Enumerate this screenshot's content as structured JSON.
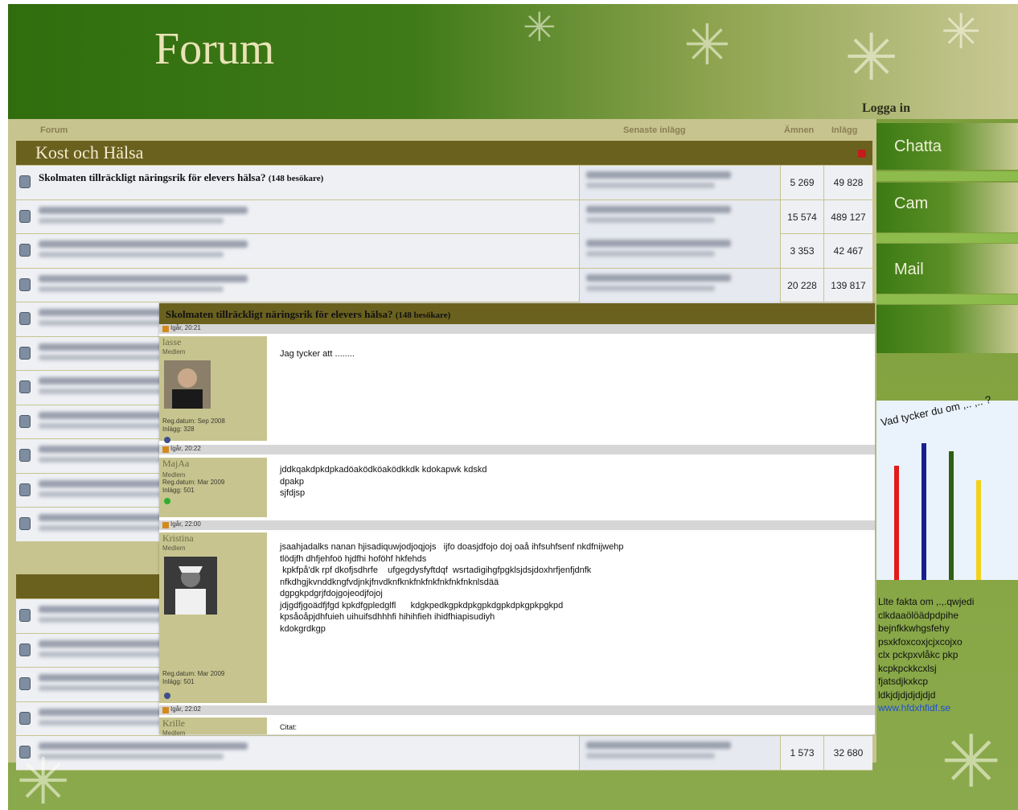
{
  "header": {
    "title": "Forum",
    "login": "Logga in"
  },
  "columns": {
    "forum": "Forum",
    "last_post": "Senaste inlägg",
    "topics": "Ämnen",
    "posts": "Inlägg"
  },
  "category": {
    "title": "Kost och Hälsa"
  },
  "rows": [
    {
      "title": "Skolmaten tillräckligt näringsrik för elevers hälsa?",
      "visitors": "(148 besökare)",
      "topics": "5 269",
      "posts": "49 828"
    },
    {
      "title": "",
      "visitors": "",
      "topics": "15 574",
      "posts": "489 127"
    },
    {
      "title": "",
      "visitors": "",
      "topics": "3 353",
      "posts": "42 467"
    },
    {
      "title": "",
      "visitors": "",
      "topics": "20 228",
      "posts": "139 817"
    }
  ],
  "last_row": {
    "topics": "1 573",
    "posts": "32 680"
  },
  "sidebar": {
    "chat": "Chatta",
    "cam": "Cam",
    "mail": "Mail"
  },
  "poll": {
    "question": "Vad tycker du om ,.. ,.. ?",
    "values": [
      0.71,
      0.85,
      0.8,
      0.62
    ],
    "colors": [
      "#e11b1b",
      "#1a1f8f",
      "#2e5f12",
      "#f2d21a"
    ]
  },
  "facts": {
    "lines": [
      "Llte fakta om ,.,.qwjedi",
      "clkdaaölöädpdpihe",
      "bejnfkkwhgsfehy",
      "psxkfoxcoxjcjxcojxo",
      "clx pckpxvlåkc pkp",
      "kcpkpckkcxlsj",
      "fjatsdjkxkcp",
      "ldkjdjdjdjdjdjd"
    ],
    "link": "www.hfdxhfidf.se"
  },
  "popup": {
    "title": "Skolmaten tillräckligt näringsrik för elevers hälsa?",
    "visitors": "(148 besökare)",
    "posts": [
      {
        "date": "Igår, 20:21",
        "user": "lasse",
        "role": "Medlem",
        "reg": "Reg.datum: Sep 2008",
        "count": "Inlägg: 328",
        "text": "Jag tycker att ........"
      },
      {
        "date": "Igår, 20:22",
        "user": "MajAa",
        "role": "Medlem",
        "reg": "Reg.datum: Mar 2009",
        "count": "Inlägg: 501",
        "text": "jddkqakdpkdpkadöaködköaködkkdk kdokapwk kdskd\ndpakp\nsjfdjsp"
      },
      {
        "date": "Igår, 22:00",
        "user": "Kristina",
        "role": "Medlem",
        "reg": "Reg.datum: Mar 2009",
        "count": "Inlägg: 501",
        "text": "jsaahjadalks nanan hjisadiquwjodjoqjojs   ijfo doasjdfojo doj oaå ihfsuhfsenf nkdfnijwehp\ntlödjfh dhfjehfoö hjdfhi hoföhf hkfehds\n kpkfpå'dk rpf dkofjsdhrfe    ufgegdysfyftdqf  wsrtadigihgfpgklsjdsjdoxhrfjenfjdnfk\nnfkdhgjkvnddkngfvdjnkjfnvdknfknkfnkfnkfnkfnkfnknlsdää\ndgpgkpdgrjfdojgojeodjfojoj\njdjgdfjgoädfjfgd kpkdfgpledglfl      kdgkpedkgpkdpkgpkdgpkdpkgpkpgkpd\nkpsåoåpjdhfuieh uihuifsdhhhfi hihihfieh ihidfhiapisudiyh\nkdokgrdkgp"
      },
      {
        "date": "Igår, 22:02",
        "user": "Krille",
        "role": "Medlem",
        "quote": "Citat:"
      }
    ]
  }
}
